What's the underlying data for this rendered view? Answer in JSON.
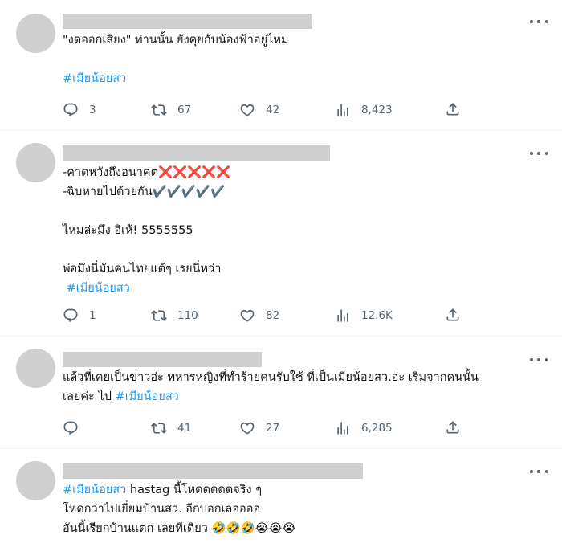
{
  "tweets": [
    {
      "lines": [
        {
          "segments": [
            {
              "text": "\"งดออกเสียง\" ท่านนั้น ยังคุยกับน้องฟ้าอยู่ไหม",
              "tag": false
            }
          ]
        },
        null,
        {
          "segments": [
            {
              "text": "#เมียน้อยสว",
              "tag": true
            }
          ]
        }
      ],
      "stats": {
        "replies": "3",
        "retweets": "67",
        "likes": "42",
        "views": "8,423"
      }
    },
    {
      "lines": [
        {
          "segments": [
            {
              "text": "-คาดหวังถึงอนาคต❌❌❌❌❌",
              "tag": false
            }
          ]
        },
        {
          "segments": [
            {
              "text": "-ฉิบหายไปด้วยกัน✔️✔️✔️✔️✔️",
              "tag": false
            }
          ]
        },
        null,
        {
          "segments": [
            {
              "text": "ไหมล่ะมึง อิเห้! 5555555",
              "tag": false
            }
          ]
        },
        null,
        {
          "segments": [
            {
              "text": "พ่อมึงนี่มันคนไทยแต้ๆ เรยนี่หว่า",
              "tag": false
            }
          ]
        },
        {
          "segments": [
            {
              "text": " #เมียน้อยสว",
              "tag": true
            }
          ]
        }
      ],
      "stats": {
        "replies": "1",
        "retweets": "110",
        "likes": "82",
        "views": "12.6K"
      }
    },
    {
      "lines": [
        {
          "segments": [
            {
              "text": "แล้วที่เคยเป็นข่าวอ่ะ ทหารหญิงที่ทำร้ายคนรับใช้ ที่เป็นเมียน้อยสว.อ่ะ เริ่มจากคนนั้น",
              "tag": false
            }
          ]
        },
        {
          "segments": [
            {
              "text": "เลยค่ะ ไป ",
              "tag": false
            },
            {
              "text": "#เมียน้อยสว",
              "tag": true
            }
          ]
        }
      ],
      "stats": {
        "replies": "",
        "retweets": "41",
        "likes": "27",
        "views": "6,285"
      }
    },
    {
      "lines": [
        {
          "segments": [
            {
              "text": "#เมียน้อยสว",
              "tag": true
            },
            {
              "text": " hastag นี้โหดดดดดจริง ๆ",
              "tag": false
            }
          ]
        },
        {
          "segments": [
            {
              "text": "โหดกว่าไปเยี่ยมบ้านสว. อีกบอกเลออออ",
              "tag": false
            }
          ]
        },
        {
          "segments": [
            {
              "text": "อันนี้เรียกบ้านแตก เลยทีเดียว 🤣🤣🤣😭😭😭",
              "tag": false
            }
          ]
        }
      ],
      "stats": null
    }
  ],
  "colors": {
    "accent": "#1d9bf0",
    "muted": "#536471",
    "placeholder": "#cfcfcf"
  },
  "icons": {
    "reply": "reply-icon",
    "retweet": "retweet-icon",
    "like": "heart-icon",
    "views": "views-icon",
    "share": "share-icon",
    "more": "more-dots-icon"
  }
}
